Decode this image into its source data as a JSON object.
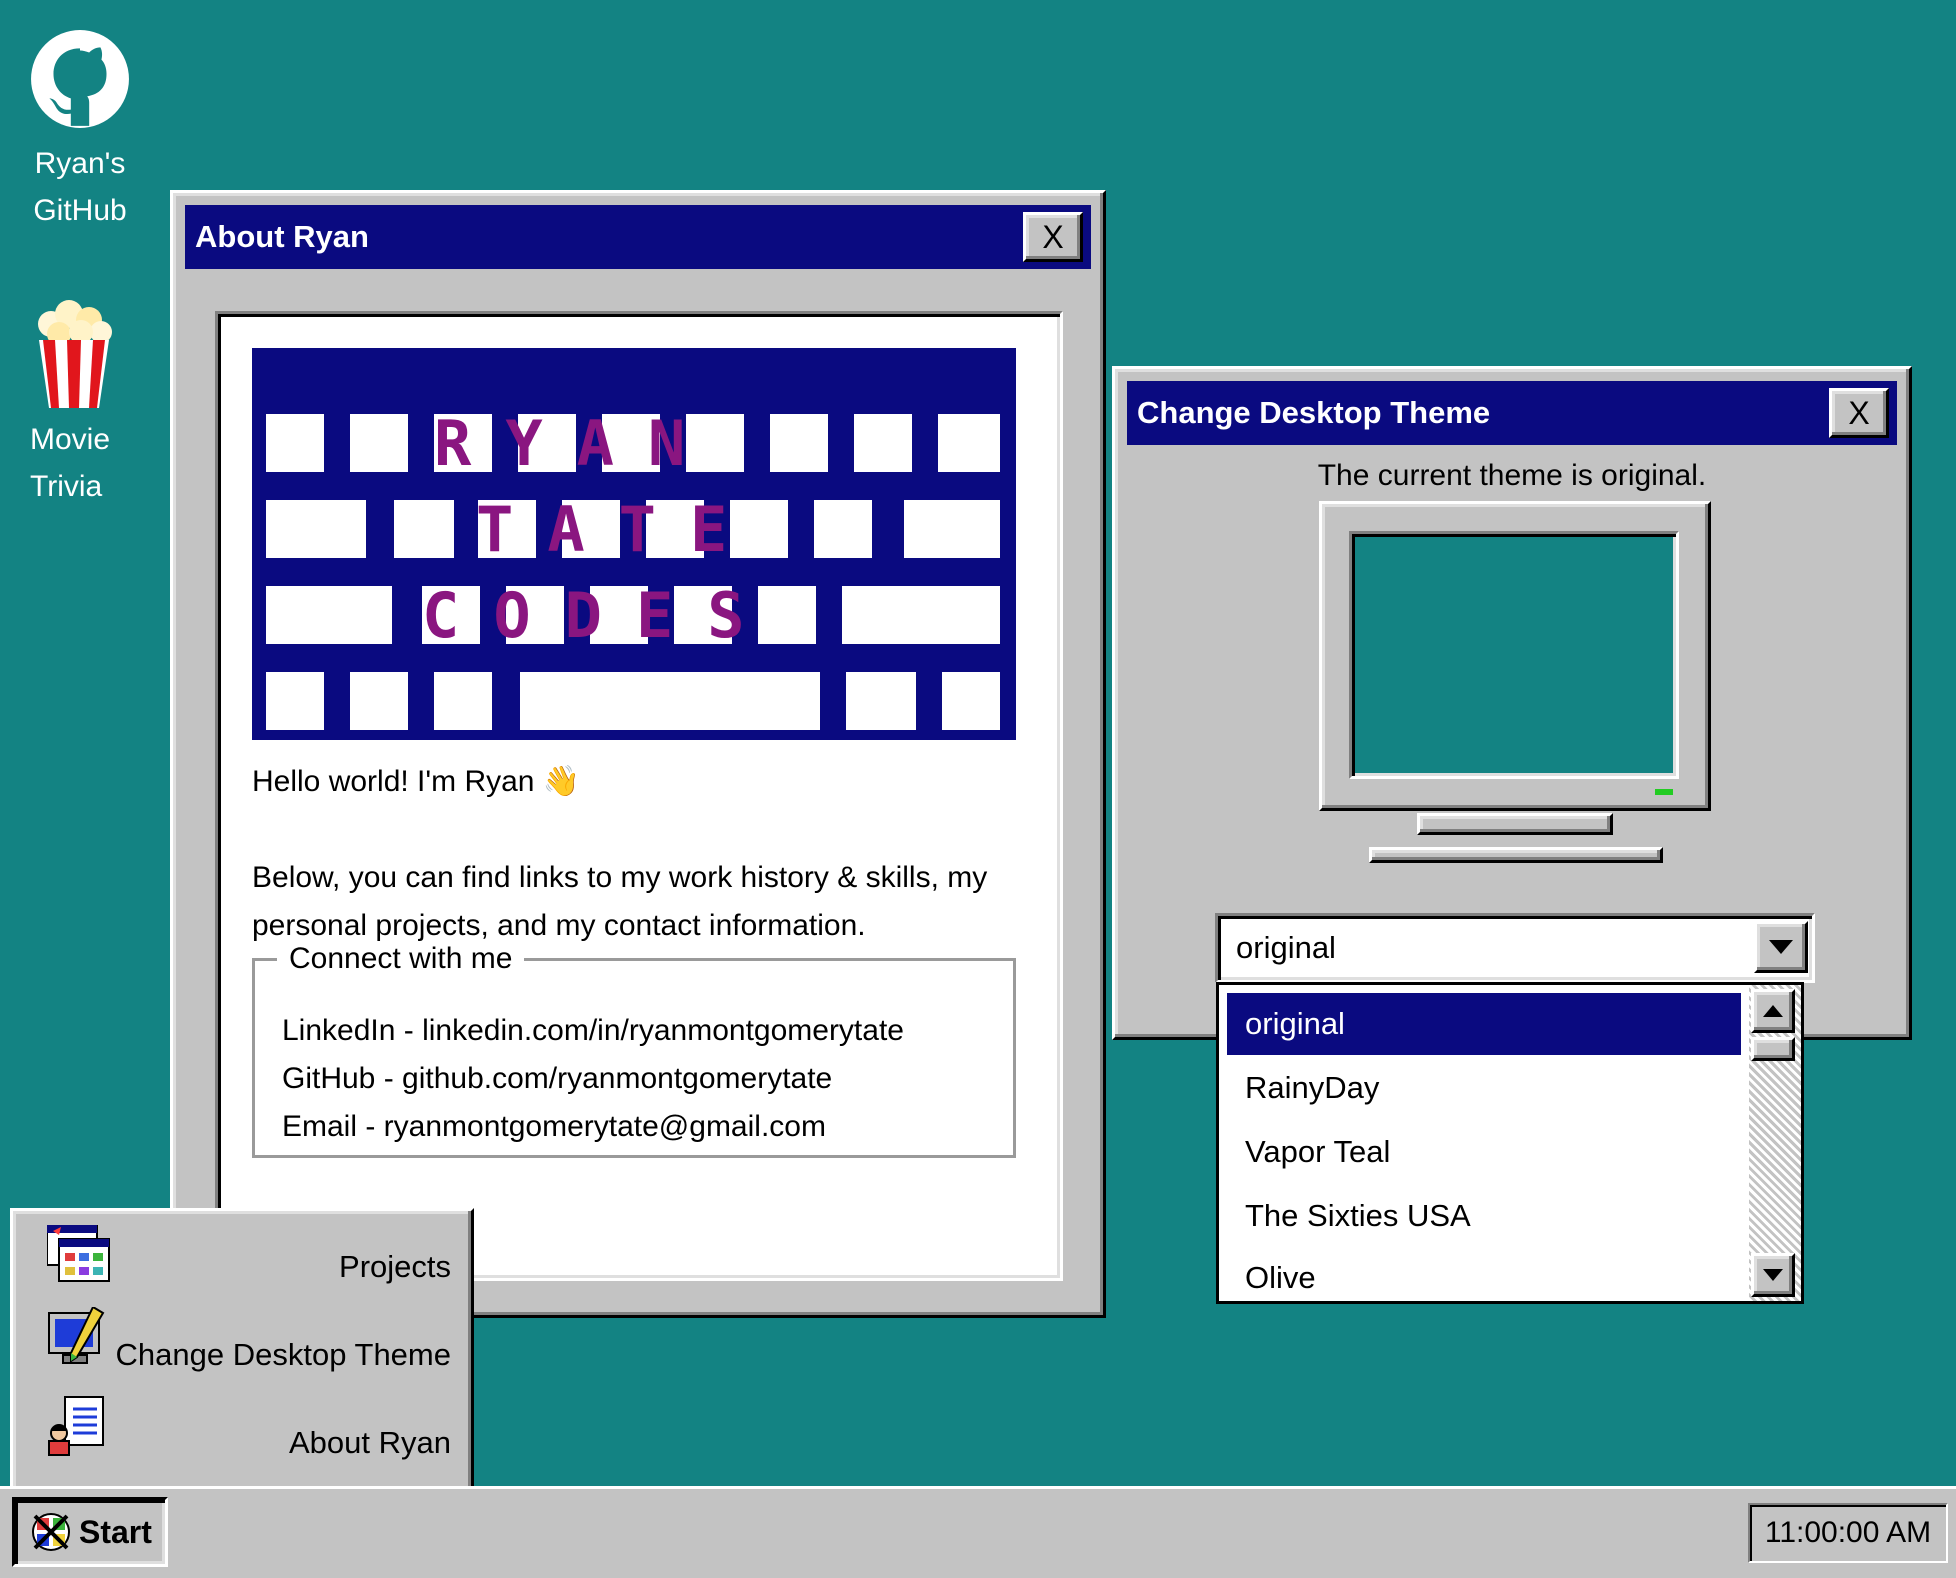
{
  "desktop": {
    "icons": [
      {
        "label": "Ryan's GitHub",
        "icon": "github-icon"
      },
      {
        "label": "Movie Trivia",
        "icon": "popcorn-icon"
      }
    ]
  },
  "about_window": {
    "title": "About Ryan",
    "close_label": "X",
    "banner_lines": [
      "RYAN",
      "TATE",
      "CODES"
    ],
    "greeting": "Hello world! I'm Ryan 👋",
    "description": "Below, you can find links to my work history & skills, my personal projects, and my contact information.",
    "connect": {
      "legend": "Connect with me",
      "links": [
        "LinkedIn - linkedin.com/in/ryanmontgomerytate",
        "GitHub - github.com/ryanmontgomerytate",
        "Email - ryanmontgomerytate@gmail.com"
      ]
    }
  },
  "theme_window": {
    "title": "Change Desktop Theme",
    "close_label": "X",
    "current_text": "The current theme is original.",
    "selected_value": "original",
    "options": [
      "original",
      "RainyDay",
      "Vapor Teal",
      "The Sixties USA",
      "Olive"
    ],
    "highlighted_index": 0,
    "preview_color": "#138383"
  },
  "start_menu": {
    "items": [
      {
        "label": "Projects",
        "icon": "projects-icon"
      },
      {
        "label": "Change Desktop Theme",
        "icon": "display-properties-icon"
      },
      {
        "label": "About Ryan",
        "icon": "user-document-icon"
      }
    ]
  },
  "taskbar": {
    "start_label": "Start",
    "clock": "11:00:00 AM"
  },
  "colors": {
    "desktop": "#138383",
    "titlebar": "#0a0a80",
    "window_face": "#c3c3c3",
    "banner_text": "#8a1680"
  }
}
